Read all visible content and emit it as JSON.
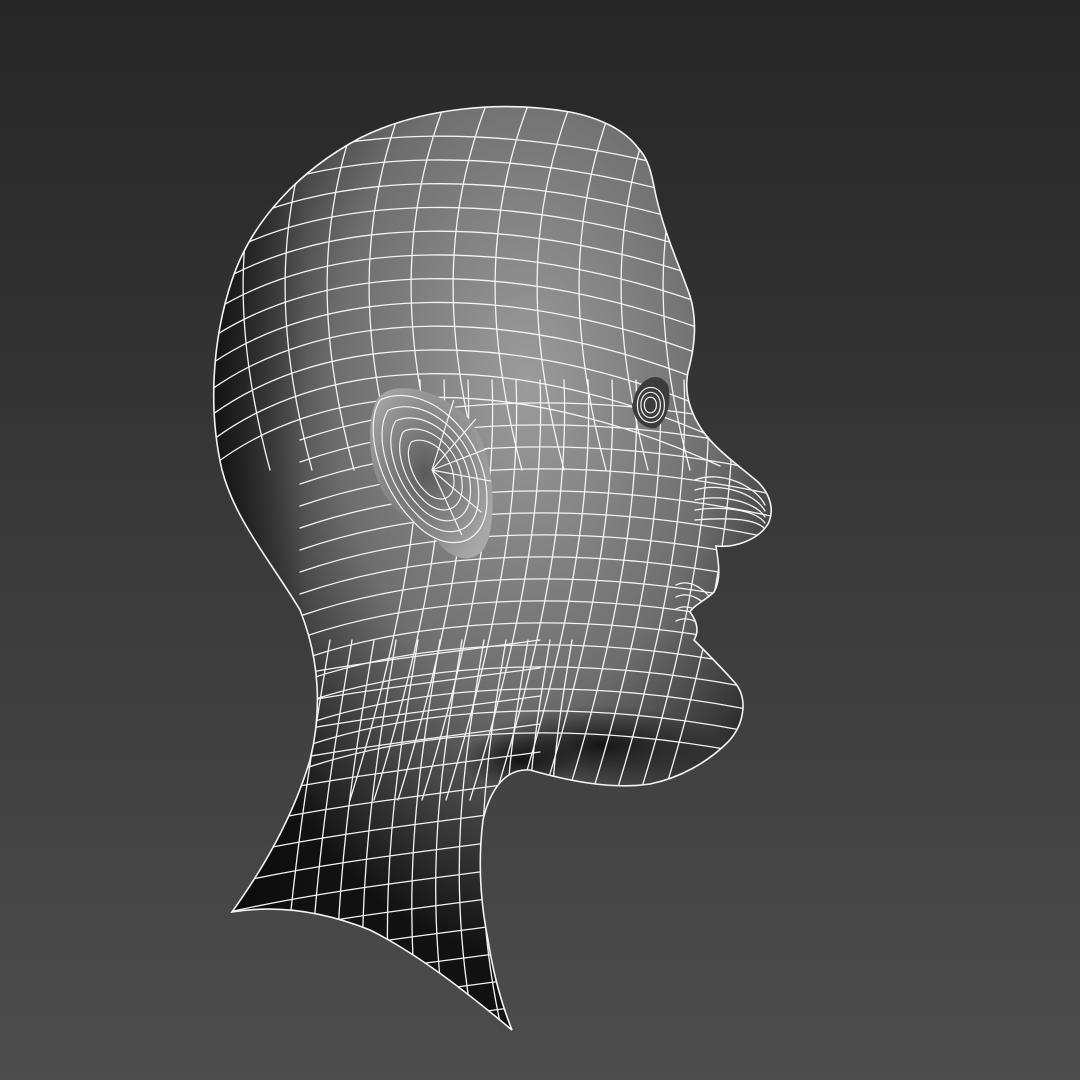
{
  "viewport": {
    "background_top": "#262626",
    "background_bottom": "#4d4d4d",
    "display_mode": "wireframe-over-shaded",
    "wire_color": "#f4f4f4",
    "skin_light": "#9c9c9c",
    "skin_mid": "#6e6e6e",
    "skin_dark": "#111111"
  },
  "model": {
    "subject": "head-and-neck",
    "orientation": "profile-right"
  }
}
